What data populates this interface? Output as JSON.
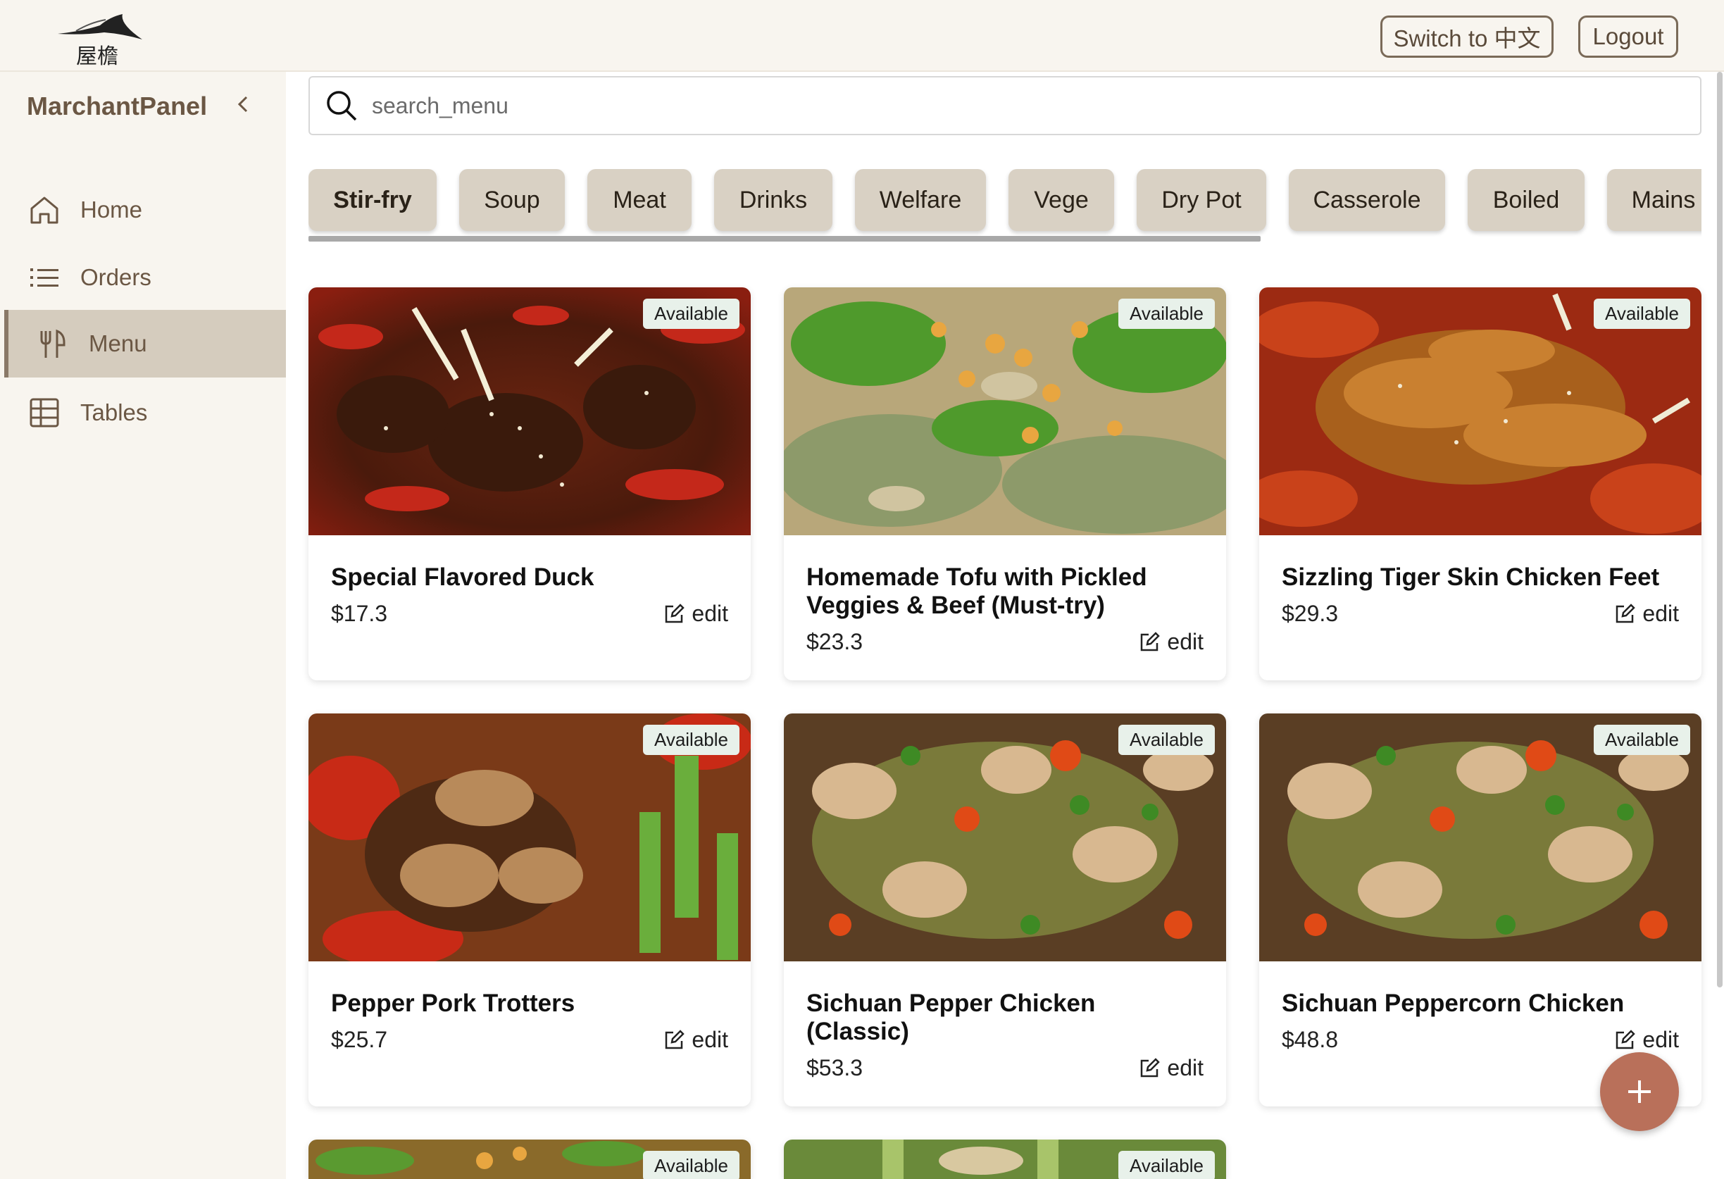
{
  "header": {
    "switch_lang_label": "Switch to 中文",
    "logout_label": "Logout"
  },
  "sidebar": {
    "brand": "MarchantPanel",
    "items": [
      {
        "label": "Home",
        "icon": "home-icon"
      },
      {
        "label": "Orders",
        "icon": "list-icon"
      },
      {
        "label": "Menu",
        "icon": "fork-knife-icon",
        "active": true
      },
      {
        "label": "Tables",
        "icon": "table-grid-icon"
      }
    ]
  },
  "search": {
    "placeholder": "search_menu"
  },
  "categories": [
    "Stir-fry",
    "Soup",
    "Meat",
    "Drinks",
    "Welfare",
    "Vege",
    "Dry Pot",
    "Casserole",
    "Boiled",
    "Mains"
  ],
  "menu_items": [
    {
      "name": "Special Flavored Duck",
      "price": "$17.3",
      "status": "Available",
      "edit_label": "edit"
    },
    {
      "name": "Homemade Tofu with Pickled Veggies & Beef (Must-try)",
      "price": "$23.3",
      "status": "Available",
      "edit_label": "edit"
    },
    {
      "name": "Sizzling Tiger Skin Chicken Feet",
      "price": "$29.3",
      "status": "Available",
      "edit_label": "edit"
    },
    {
      "name": "Pepper Pork Trotters",
      "price": "$25.7",
      "status": "Available",
      "edit_label": "edit"
    },
    {
      "name": "Sichuan Pepper Chicken (Classic)",
      "price": "$53.3",
      "status": "Available",
      "edit_label": "edit"
    },
    {
      "name": "Sichuan Peppercorn Chicken",
      "price": "$48.8",
      "status": "Available",
      "edit_label": "edit"
    },
    {
      "status": "Available"
    },
    {
      "status": "Available"
    }
  ],
  "colors": {
    "accent": "#b9705a",
    "sidebar_bg": "#f8f5ef",
    "active_nav": "#d5ccbe",
    "category_bg": "#d9d1c4",
    "brand_text": "#6b5744"
  }
}
